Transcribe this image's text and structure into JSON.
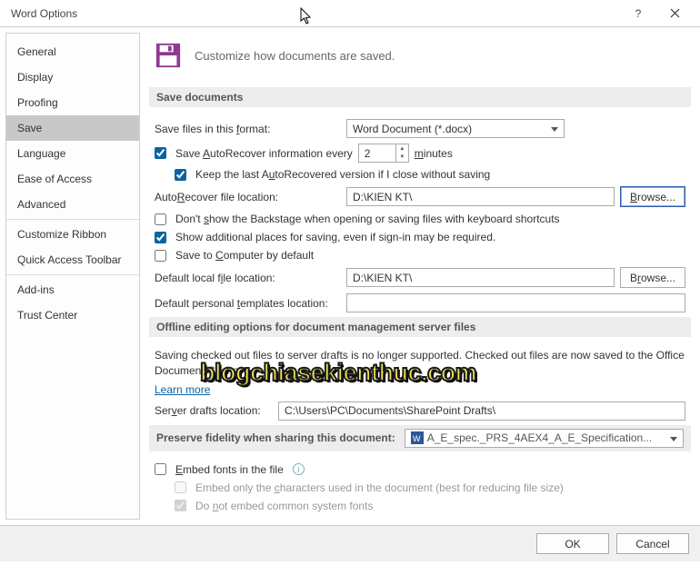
{
  "window": {
    "title": "Word Options"
  },
  "sidebar": {
    "items": [
      {
        "label": "General"
      },
      {
        "label": "Display"
      },
      {
        "label": "Proofing"
      },
      {
        "label": "Save",
        "active": true
      },
      {
        "label": "Language"
      },
      {
        "label": "Ease of Access"
      },
      {
        "label": "Advanced"
      },
      {
        "label": "Customize Ribbon"
      },
      {
        "label": "Quick Access Toolbar"
      },
      {
        "label": "Add-ins"
      },
      {
        "label": "Trust Center"
      }
    ]
  },
  "header": {
    "text": "Customize how documents are saved."
  },
  "save_section": {
    "title": "Save documents",
    "format_label": "Save files in this format:",
    "format_value": "Word Document (*.docx)",
    "autorecover_checkbox": "Save AutoRecover information every",
    "autorecover_value": "2",
    "autorecover_unit": "minutes",
    "keep_last": "Keep the last AutoRecovered version if I close without saving",
    "ar_location_label": "AutoRecover file location:",
    "ar_location_value": "D:\\KIEN KT\\",
    "browse": "Browse...",
    "dont_show_backstage": "Don't show the Backstage when opening or saving files with keyboard shortcuts",
    "show_additional": "Show additional places for saving, even if sign-in may be required.",
    "save_to_computer": "Save to Computer by default",
    "default_local_label": "Default local file location:",
    "default_local_value": "D:\\KIEN KT\\",
    "default_templates_label": "Default personal templates location:",
    "default_templates_value": ""
  },
  "offline_section": {
    "title": "Offline editing options for document management server files",
    "note": "Saving checked out files to server drafts is no longer supported. Checked out files are now saved to the Office Document Cache.",
    "learn_more": "Learn more",
    "drafts_label": "Server drafts location:",
    "drafts_value": "C:\\Users\\PC\\Documents\\SharePoint Drafts\\"
  },
  "preserve_section": {
    "title": "Preserve fidelity when sharing this document:",
    "doc_name": "A_E_spec._PRS_4AEX4_A_E_Specification...",
    "embed_fonts": "Embed fonts in the file",
    "embed_chars": "Embed only the characters used in the document (best for reducing file size)",
    "no_common": "Do not embed common system fonts"
  },
  "footer": {
    "ok": "OK",
    "cancel": "Cancel"
  },
  "watermark": "blogchiasekienthuc.com"
}
